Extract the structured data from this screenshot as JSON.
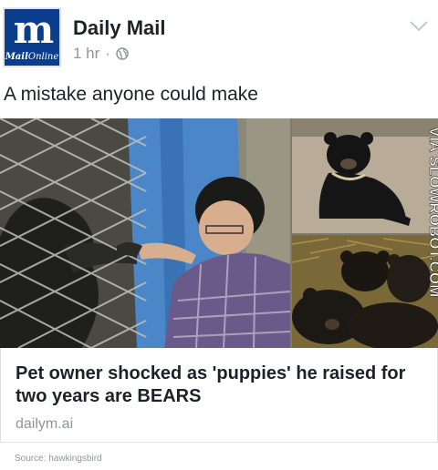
{
  "post": {
    "page_name": "Daily Mail",
    "time": "1 hr",
    "separator": "·",
    "avatar": {
      "logo_mark": "m",
      "logo_bold": "Mail",
      "logo_rest": "Online",
      "color": "#0a3d8c"
    },
    "caption": "A mistake anyone could make"
  },
  "link_preview": {
    "title": "Pet owner shocked as 'puppies' he raised for two years are BEARS",
    "domain": "dailym.ai",
    "watermark": "VIA SLOWROBOT.COM"
  },
  "footer": {
    "source": "Source: hawkingsbird"
  },
  "icons": {
    "globe": "globe-icon",
    "chevron": "chevron-down-icon"
  }
}
